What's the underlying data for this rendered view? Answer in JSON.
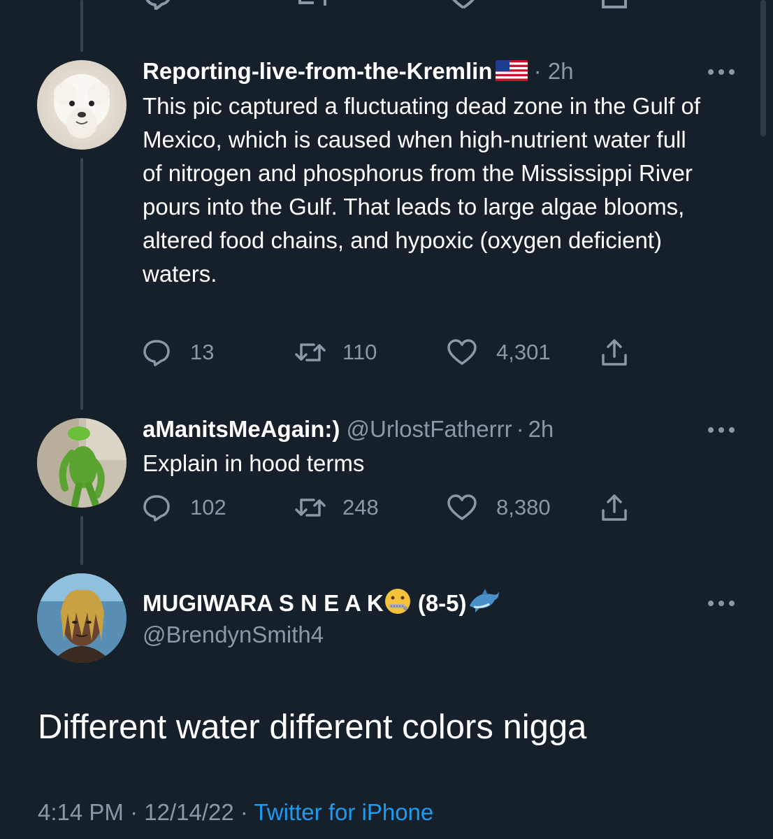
{
  "tweets": [
    {
      "display_name": "Reporting-live-from-the-Kremlin",
      "flag_icon": "us-flag-icon",
      "separator": "·",
      "time": "2h",
      "text": "This pic captured a fluctuating dead zone in the Gulf of Mexico, which is caused when high-nutrient water full of nitrogen and phosphorus from the Mississippi River pours into the Gulf. That leads to large algae blooms, altered food chains, and hypoxic (oxygen deficient) waters.",
      "replies": "13",
      "retweets": "110",
      "likes": "4,301"
    },
    {
      "display_name": "aManitsMeAgain:)",
      "handle": "@UrlostFatherrr",
      "separator": "·",
      "time": "2h",
      "text": "Explain in hood terms",
      "replies": "102",
      "retweets": "248",
      "likes": "8,380"
    }
  ],
  "main_tweet": {
    "display_name": "MUGIWARA S N E A K",
    "name_suffix": "(8-5)",
    "name_emoji_1": "zipper-mouth-face-emoji",
    "name_emoji_2": "dolphin-emoji",
    "handle": "@BrendynSmith4",
    "text": "Different water different colors nigga",
    "time": "4:14 PM",
    "date": "12/14/22",
    "separator": "·",
    "source": "Twitter for iPhone"
  },
  "colors": {
    "background": "#15202b",
    "secondary_text": "#8b98a5",
    "link": "#1d9bf0",
    "thread_line": "#38444d"
  }
}
